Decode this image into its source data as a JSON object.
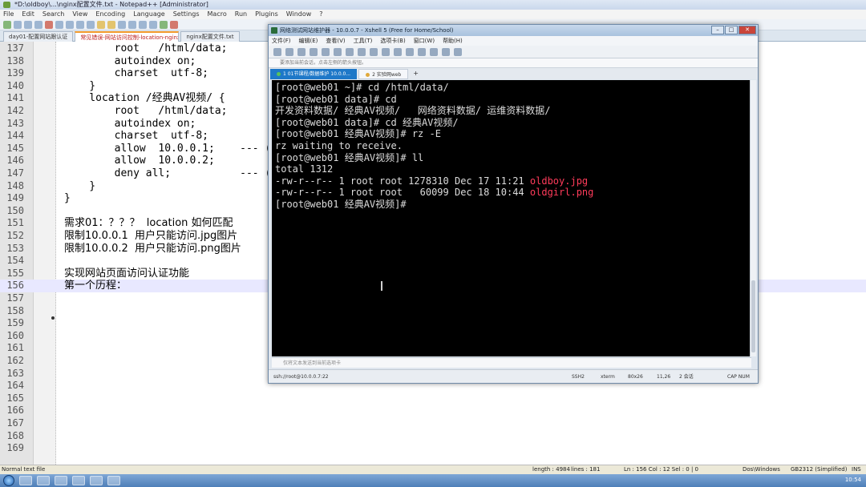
{
  "npp": {
    "title": "*D:\\oldboy\\...\\nginx配置文件.txt - Notepad++ [Administrator]",
    "menu": [
      "File",
      "Edit",
      "Search",
      "View",
      "Encoding",
      "Language",
      "Settings",
      "Macro",
      "Run",
      "Plugins",
      "Window",
      "?"
    ],
    "tabs": [
      "day01-配置网站跟认证",
      "常见错误-网站访问控制-location-nginx-匹配",
      "nginx配置文件.txt"
    ],
    "active_tab_index": 1
  },
  "editor": {
    "lines": [
      {
        "num": "137",
        "code": "        root   /html/data;"
      },
      {
        "num": "138",
        "code": "        autoindex on;"
      },
      {
        "num": "139",
        "code": "        charset  utf-8;"
      },
      {
        "num": "140",
        "code": "    }"
      },
      {
        "num": "141",
        "code": "    location /经典AV视频/ {"
      },
      {
        "num": "142",
        "code": "        root   /html/data;"
      },
      {
        "num": "143",
        "code": "        autoindex on;"
      },
      {
        "num": "144",
        "code": "        charset  utf-8;"
      },
      {
        "num": "145",
        "code": "        allow  10.0.0.1;    --- ("
      },
      {
        "num": "146",
        "code": "        allow  10.0.0.2;"
      },
      {
        "num": "147",
        "code": "        deny all;           --- ("
      },
      {
        "num": "148",
        "code": "    }"
      },
      {
        "num": "149",
        "code": "}"
      },
      {
        "num": "150",
        "code": ""
      },
      {
        "num": "151",
        "code": "需求01：？？？  location 如何匹配"
      },
      {
        "num": "152",
        "code": "限制10.0.0.1  用户只能访问.jpg图片"
      },
      {
        "num": "153",
        "code": "限制10.0.0.2  用户只能访问.png图片"
      },
      {
        "num": "154",
        "code": ""
      },
      {
        "num": "155",
        "code": "实现网站页面访问认证功能"
      },
      {
        "num": "156",
        "code": "第一个历程："
      },
      {
        "num": "157",
        "code": ""
      },
      {
        "num": "158",
        "code": ""
      },
      {
        "num": "159",
        "code": ""
      },
      {
        "num": "160",
        "code": ""
      },
      {
        "num": "161",
        "code": ""
      },
      {
        "num": "162",
        "code": ""
      },
      {
        "num": "163",
        "code": ""
      },
      {
        "num": "164",
        "code": ""
      },
      {
        "num": "165",
        "code": ""
      },
      {
        "num": "166",
        "code": ""
      },
      {
        "num": "167",
        "code": ""
      },
      {
        "num": "168",
        "code": ""
      },
      {
        "num": "169",
        "code": ""
      }
    ]
  },
  "npp_status": {
    "file_type": "Normal text file",
    "length": "length : 4984",
    "lines": "lines : 181",
    "position": "Ln : 156   Col : 12   Sel : 0 | 0",
    "eol": "Dos\\Windows",
    "encoding": "GB2312 (Simplified)",
    "ins": "INS"
  },
  "xshell": {
    "title": "网络测试网站维护器 - 10.0.0.7 - Xshell 5 (Free for Home/School)",
    "menu": [
      "文件(F)",
      "编辑(E)",
      "查看(V)",
      "工具(T)",
      "选项卡(B)",
      "窗口(W)",
      "帮助(H)"
    ],
    "address_hint": "要添加当前会话，点击左侧的箭头按钮。",
    "tabs": [
      {
        "label": "1 01节课程/数据维护 10.0.0..."
      },
      {
        "label": "2 实验网web"
      }
    ],
    "terminal_lines": [
      [
        {
          "t": "[root@web01 ~]# cd /html/data/"
        }
      ],
      [
        {
          "t": "[root@web01 data]# cd"
        }
      ],
      [
        {
          "t": "开发资料数据/ 经典AV视频/   网络资料数据/ 运维资料数据/"
        }
      ],
      [
        {
          "t": "[root@web01 data]# cd 经典AV视频/"
        }
      ],
      [
        {
          "t": "[root@web01 经典AV视频]# rz -E"
        }
      ],
      [
        {
          "t": "rz waiting to receive."
        }
      ],
      [
        {
          "t": "[root@web01 经典AV视频]# ll"
        }
      ],
      [
        {
          "t": "total 1312"
        }
      ],
      [
        {
          "t": "-rw-r--r-- 1 root root 1278310 Dec 17 11:21 "
        },
        {
          "t": "oldboy.jpg",
          "c": "red"
        }
      ],
      [
        {
          "t": "-rw-r--r-- 1 root root   60099 Dec 18 10:44 "
        },
        {
          "t": "oldgirl.png",
          "c": "red"
        }
      ],
      [
        {
          "t": "[root@web01 经典AV视频]# "
        }
      ]
    ],
    "compose_hint": "仅将文本发送到当前选项卡",
    "status": {
      "session": "ssh://root@10.0.0.7:22",
      "protocol": "SSH2",
      "term": "xterm",
      "size": "80x26",
      "pos": "11,26",
      "sessions": "2 会话",
      "caps": "CAP  NUM"
    }
  },
  "taskbar": {
    "clock": "10:54"
  }
}
